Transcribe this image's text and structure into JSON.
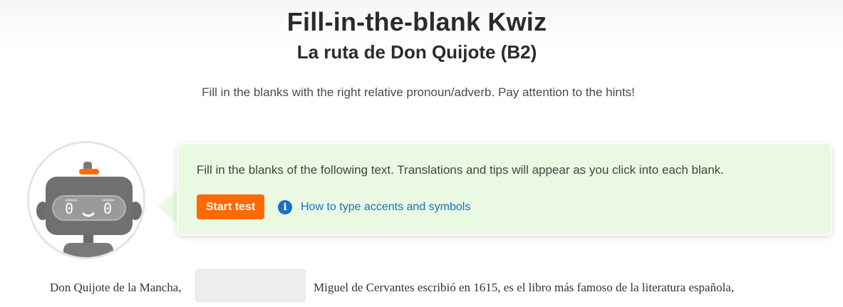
{
  "header": {
    "title": "Fill-in-the-blank Kwiz",
    "subtitle": "La ruta de Don Quijote (B2)",
    "description": "Fill in the blanks with the right relative pronoun/adverb. Pay attention to the hints!"
  },
  "mascot": {
    "icon": "robot-icon",
    "eye_left": "0",
    "eye_right": "0"
  },
  "callout": {
    "text": "Fill in the blanks of the following text. Translations and tips will appear as you click into each blank.",
    "start_label": "Start test",
    "help_icon": "info-icon",
    "help_label": "How to type accents and symbols",
    "info_glyph": "i"
  },
  "exercise": {
    "before_blank": "Don Quijote de la Mancha,",
    "blank_value": "",
    "after_blank": "Miguel de Cervantes escribió en 1615,  es el libro más famoso de la literatura española,"
  },
  "colors": {
    "accent_orange": "#ff6a00",
    "link_blue": "#1a6fc4",
    "callout_green": "#eaf9e2"
  }
}
